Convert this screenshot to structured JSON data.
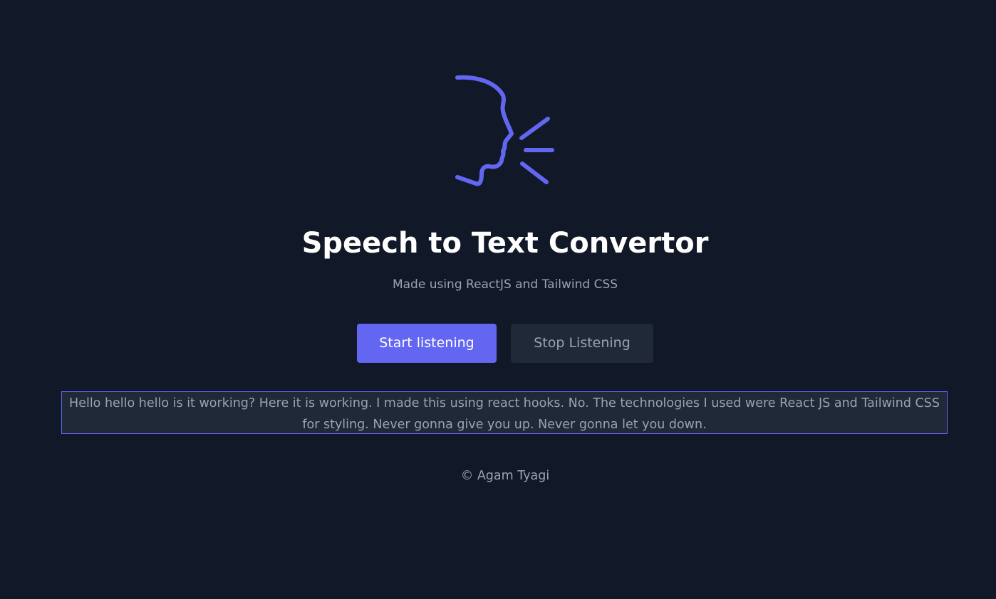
{
  "header": {
    "logo_icon": "speaking-head-icon",
    "title": "Speech to Text Convertor",
    "subtitle": "Made using ReactJS and Tailwind CSS"
  },
  "controls": {
    "start_label": "Start listening",
    "stop_label": "Stop Listening"
  },
  "transcript": {
    "text": "Hello hello hello is it working? Here it is working. I made this using react hooks. No. The technologies I used were React JS and Tailwind CSS for styling. Never gonna give you up. Never gonna let you down."
  },
  "footer": {
    "text": "© Agam Tyagi"
  },
  "colors": {
    "background": "#111827",
    "accent": "#6366f1",
    "panel": "#1f2937",
    "muted_text": "#9ca3af",
    "title_text": "#ffffff"
  }
}
